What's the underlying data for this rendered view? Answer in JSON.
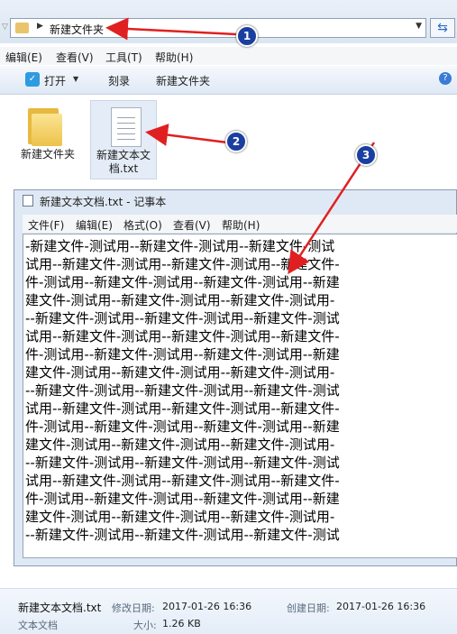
{
  "address": {
    "path": "新建文件夹"
  },
  "menu": [
    "编辑(E)",
    "查看(V)",
    "工具(T)",
    "帮助(H)"
  ],
  "commands": {
    "open": "打开",
    "burn": "刻录",
    "new_folder": "新建文件夹"
  },
  "files": [
    {
      "label": "新建文件夹"
    },
    {
      "label_line1": "新建文本文",
      "label_line2": "档.txt"
    }
  ],
  "notepad": {
    "title": "新建文本文档.txt - 记事本",
    "menu": [
      "文件(F)",
      "编辑(E)",
      "格式(O)",
      "查看(V)",
      "帮助(H)"
    ],
    "lines": [
      "-新建文件-测试用--新建文件-测试用--新建文件-测试",
      "试用--新建文件-测试用--新建文件-测试用--新建文件-",
      "件-测试用--新建文件-测试用--新建文件-测试用--新建",
      "建文件-测试用--新建文件-测试用--新建文件-测试用-",
      "--新建文件-测试用--新建文件-测试用--新建文件-测试",
      "试用--新建文件-测试用--新建文件-测试用--新建文件-",
      "件-测试用--新建文件-测试用--新建文件-测试用--新建",
      "建文件-测试用--新建文件-测试用--新建文件-测试用-",
      "--新建文件-测试用--新建文件-测试用--新建文件-测试",
      "试用--新建文件-测试用--新建文件-测试用--新建文件-",
      "件-测试用--新建文件-测试用--新建文件-测试用--新建",
      "建文件-测试用--新建文件-测试用--新建文件-测试用-",
      "--新建文件-测试用--新建文件-测试用--新建文件-测试",
      "试用--新建文件-测试用--新建文件-测试用--新建文件-",
      "件-测试用--新建文件-测试用--新建文件-测试用--新建",
      "建文件-测试用--新建文件-测试用--新建文件-测试用-",
      "--新建文件-测试用--新建文件-测试用--新建文件-测试"
    ]
  },
  "details": {
    "name": "新建文本文档.txt",
    "type": "文本文档",
    "modified_label": "修改日期:",
    "modified_value": "2017-01-26 16:36",
    "created_label": "创建日期:",
    "created_value": "2017-01-26 16:36",
    "size_label": "大小:",
    "size_value": "1.26 KB"
  },
  "annotations": [
    "1",
    "2",
    "3"
  ],
  "colors": {
    "arrow": "#e02020",
    "badge": "#1a3fa0"
  }
}
